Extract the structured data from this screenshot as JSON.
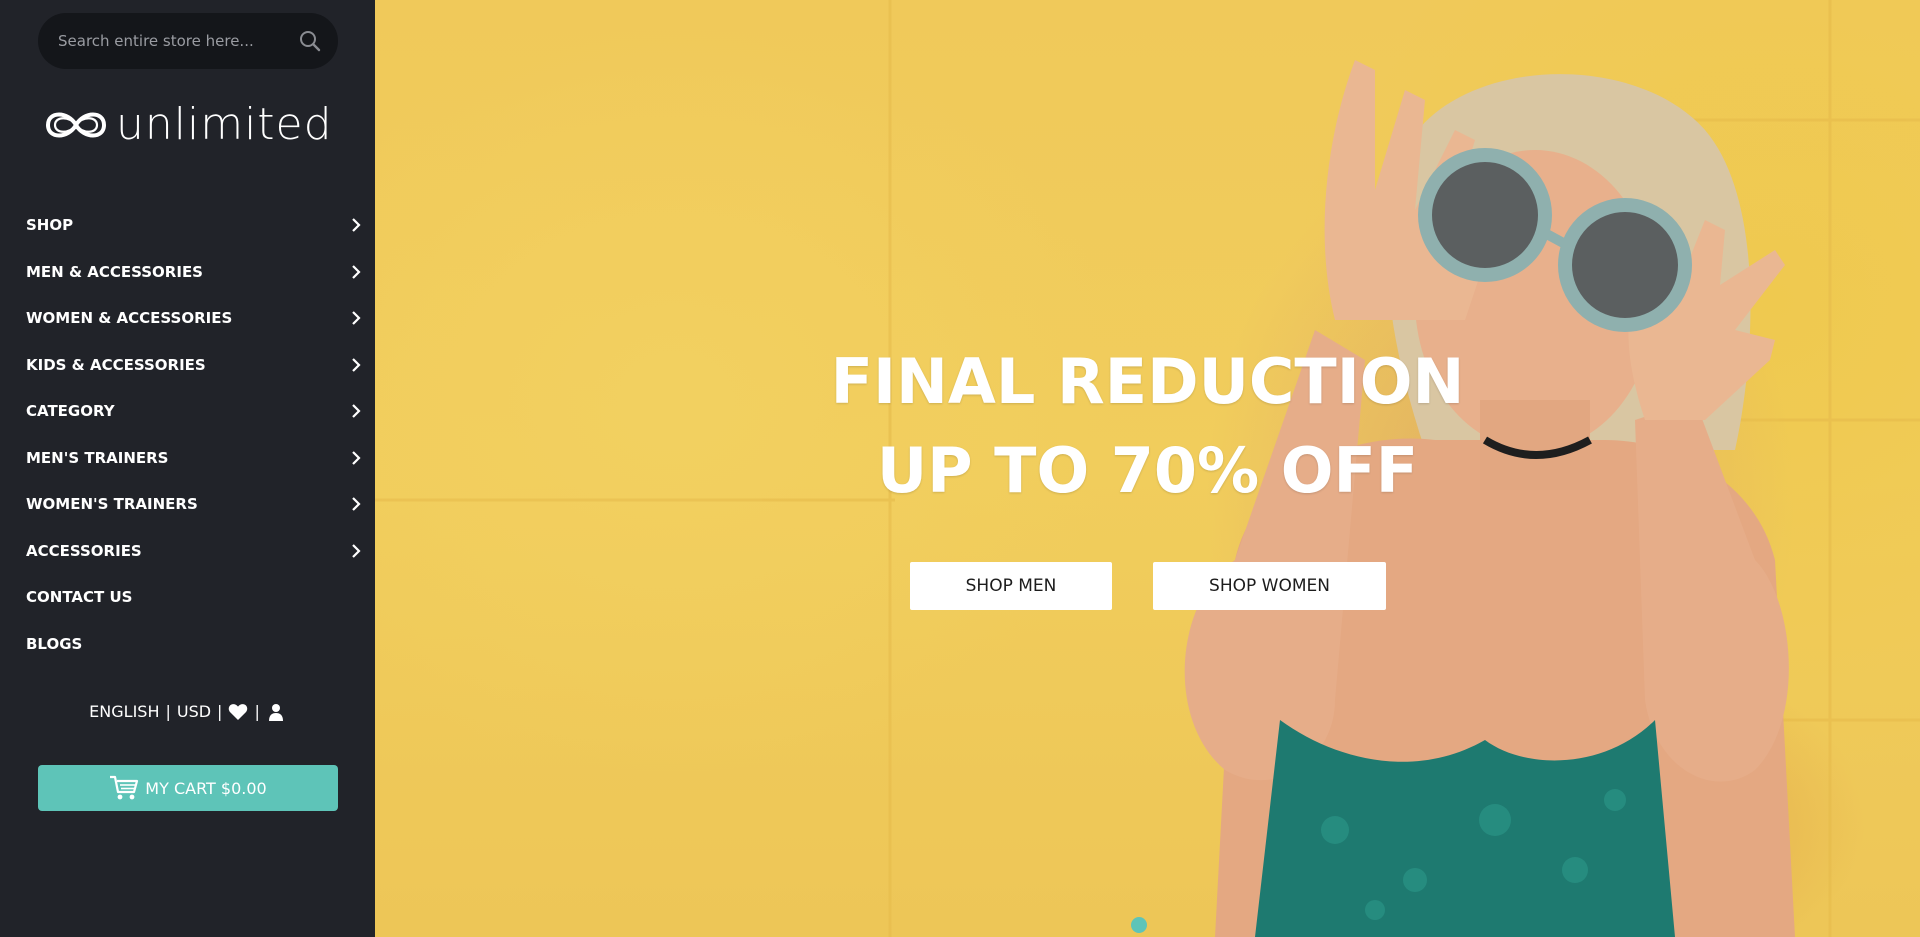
{
  "search": {
    "placeholder": "Search entire store here..."
  },
  "logo": {
    "text": "unlimited"
  },
  "nav": {
    "items": [
      {
        "label": "SHOP",
        "has_submenu": true
      },
      {
        "label": "MEN & ACCESSORIES",
        "has_submenu": true
      },
      {
        "label": "WOMEN & ACCESSORIES",
        "has_submenu": true
      },
      {
        "label": "KIDS & ACCESSORIES",
        "has_submenu": true
      },
      {
        "label": "CATEGORY",
        "has_submenu": true
      },
      {
        "label": "MEN'S TRAINERS",
        "has_submenu": true
      },
      {
        "label": "WOMEN'S TRAINERS",
        "has_submenu": true
      },
      {
        "label": "ACCESSORIES",
        "has_submenu": true
      },
      {
        "label": "CONTACT US",
        "has_submenu": false
      },
      {
        "label": "BLOGS",
        "has_submenu": false
      }
    ]
  },
  "utility": {
    "language": "ENGLISH",
    "currency": "USD",
    "separator": "|",
    "wishlist_icon": "heart-icon",
    "account_icon": "user-icon"
  },
  "cart": {
    "label": "MY CART $0.00",
    "icon": "cart-icon"
  },
  "hero": {
    "title_line1": "FINAL REDUCTION",
    "title_line2": "UP TO 70% OFF",
    "button_men": "SHOP MEN",
    "button_women": "SHOP WOMEN"
  },
  "colors": {
    "sidebar_bg": "#212329",
    "accent": "#5ec4b8",
    "hero_bg": "#f0c95a"
  }
}
